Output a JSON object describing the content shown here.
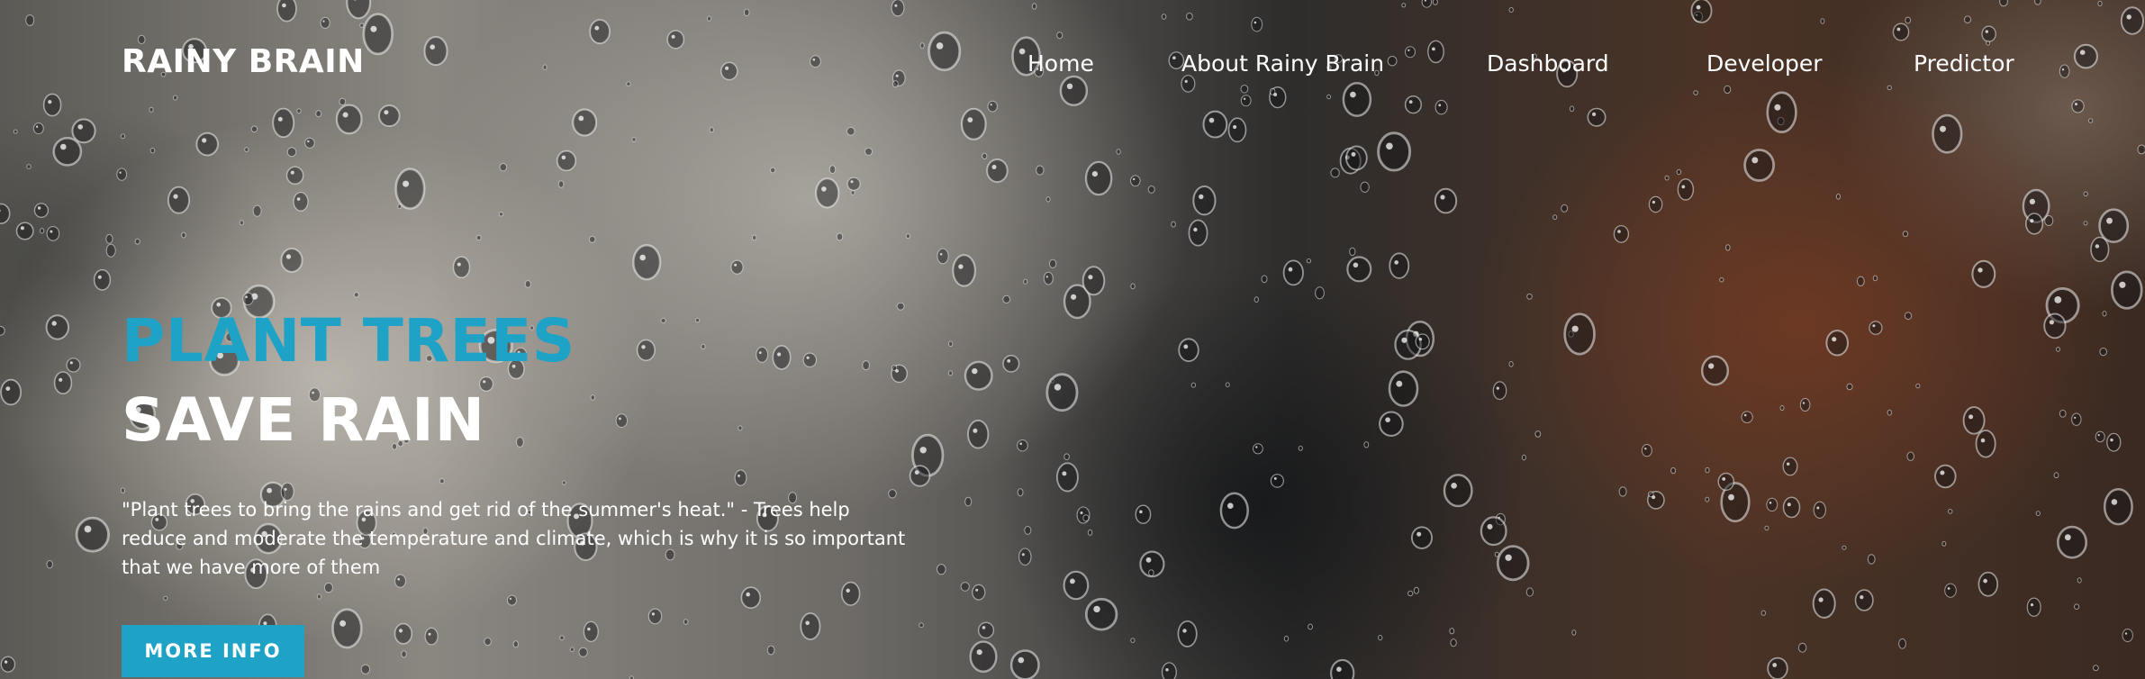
{
  "brand": {
    "name": "RAINY BRAIN"
  },
  "nav": {
    "items": [
      {
        "label": "Home"
      },
      {
        "label": "About Rainy Brain"
      },
      {
        "label": "Dashboard"
      },
      {
        "label": "Developer"
      },
      {
        "label": "Predictor"
      }
    ]
  },
  "hero": {
    "title_line_1": "PLANT TREES",
    "title_line_2": "SAVE RAIN",
    "quote": "\"Plant trees to bring the rains and get rid of the summer's heat.\" - Trees help reduce and moderate the temperature and climate, which is why it is so important that we have more of them",
    "button_label": "MORE INFO"
  },
  "colors": {
    "accent": "#1ea3c7",
    "text": "#ffffff"
  },
  "background": {
    "image": "rain-drops-on-window-icon"
  }
}
